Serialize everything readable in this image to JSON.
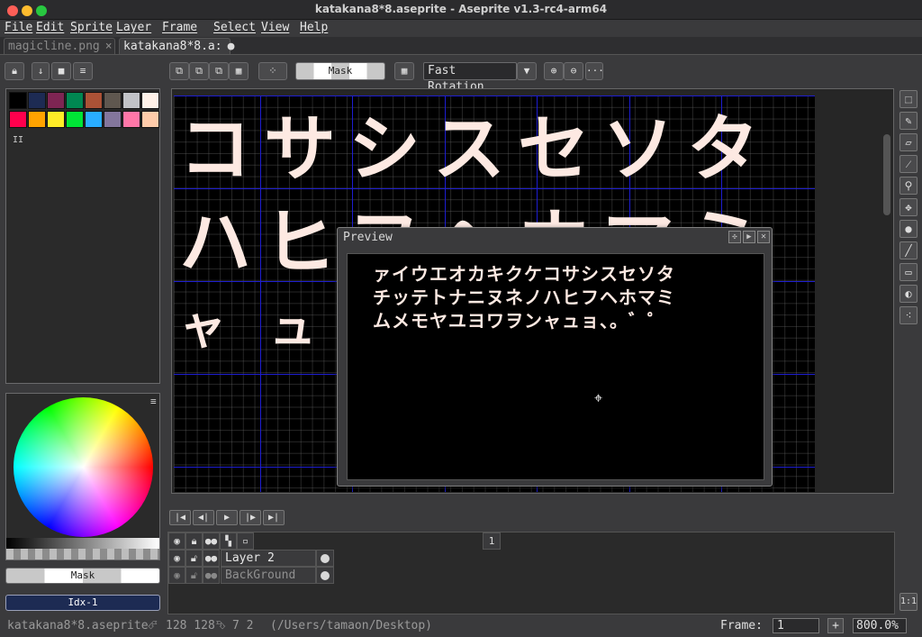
{
  "window": {
    "title": "katakana8*8.aseprite - Aseprite v1.3-rc4-arm64",
    "traffic_lights": [
      "#fe5f57",
      "#febc2e",
      "#28c840"
    ]
  },
  "menu": [
    "File",
    "Edit",
    "Sprite",
    "Layer",
    "Frame",
    "Select",
    "View",
    "Help"
  ],
  "tabs": [
    {
      "label": "magicline.png",
      "close": "×"
    },
    {
      "label": "katakana8*8.a:",
      "close": "●"
    }
  ],
  "toolbar": {
    "mask_label": "Mask",
    "rotation_select": "Fast Rotation",
    "more_label": "···"
  },
  "palette": {
    "colors": [
      "#000000",
      "#1d2b53",
      "#7e2553",
      "#008751",
      "#ab5236",
      "#5f574f",
      "#c2c3c7",
      "#fff1e8",
      "#ff004d",
      "#ffa300",
      "#ffec27",
      "#00e436",
      "#29adff",
      "#83769c",
      "#ff77a8",
      "#ffccaa"
    ],
    "pause_glyph": "II"
  },
  "color_panel": {
    "mask_label": "Mask",
    "index_label": "Idx-1"
  },
  "canvas": {
    "rows": [
      "コサシスセソタ",
      "ハヒフヘホマミ",
      "ャュョ"
    ]
  },
  "preview": {
    "title": "Preview",
    "lines": [
      "ァイウエオカキクケコサシスセソタ",
      "チッテトナニヌネノハヒフヘホマミ",
      "ムメモヤユヨワヲンャュョ、。゛゜"
    ],
    "cursor": "⌖"
  },
  "timeline": {
    "frame_number": "1",
    "layers": [
      {
        "name": "Layer 2"
      },
      {
        "name": "BackGround"
      }
    ],
    "zoom_button": "1:1"
  },
  "status": {
    "filename": "katakana8*8.aseprite",
    "size": "128 128",
    "position": "7 2",
    "path": "(/Users/tamaon/Desktop)",
    "frame_label": "Frame:",
    "frame_value": "1",
    "add_label": "+",
    "zoom": "800.0%"
  }
}
